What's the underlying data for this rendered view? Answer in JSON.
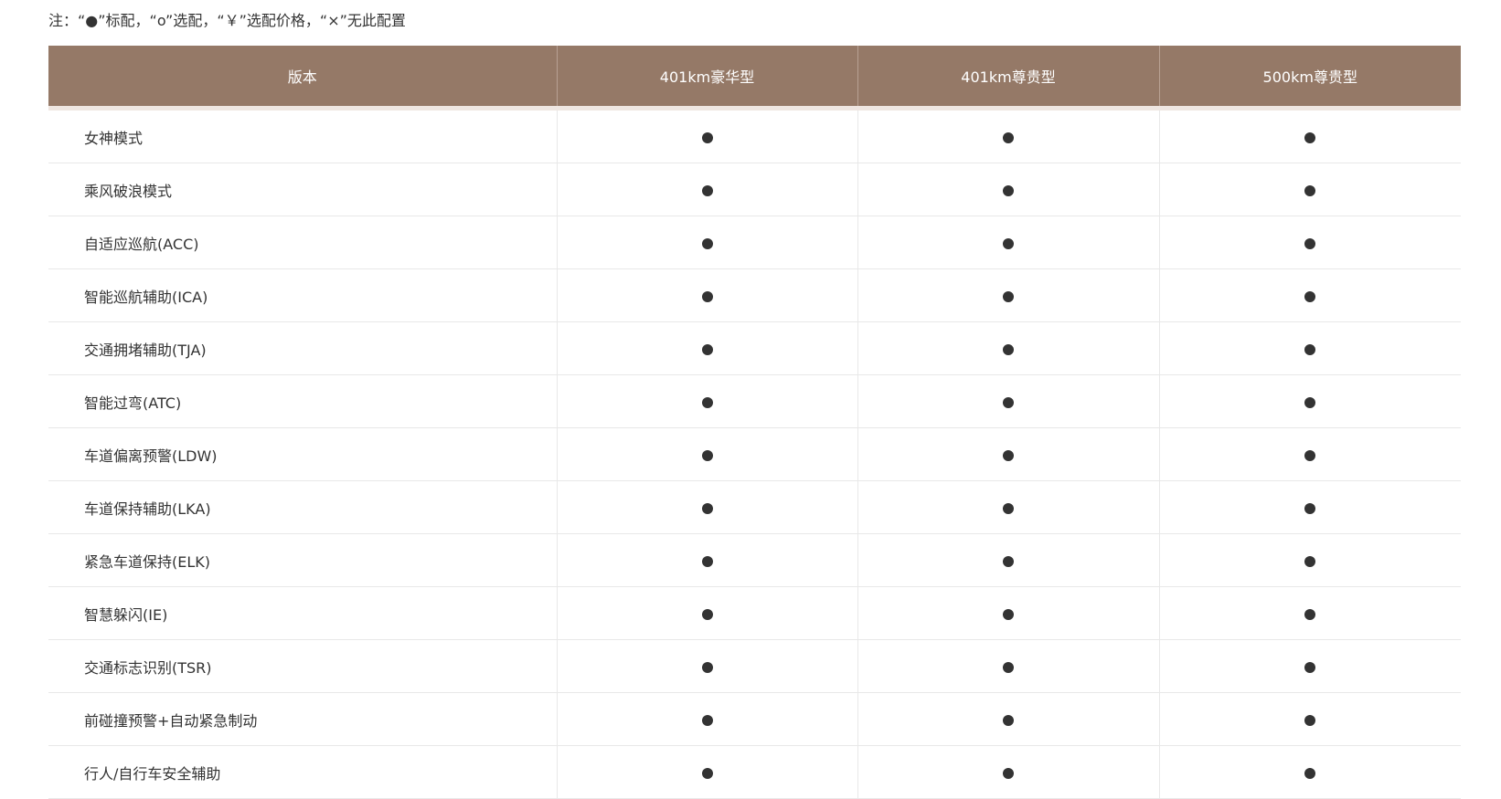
{
  "note": "注：“●”标配，“o”选配，“￥”选配价格，“×”无此配置",
  "table": {
    "headers": [
      "版本",
      "401km豪华型",
      "401km尊贵型",
      "500km尊贵型"
    ],
    "rows": [
      {
        "feature": "女神模式",
        "values": [
          "standard",
          "standard",
          "standard"
        ]
      },
      {
        "feature": "乘风破浪模式",
        "values": [
          "standard",
          "standard",
          "standard"
        ]
      },
      {
        "feature": "自适应巡航(ACC)",
        "values": [
          "standard",
          "standard",
          "standard"
        ]
      },
      {
        "feature": "智能巡航辅助(ICA)",
        "values": [
          "standard",
          "standard",
          "standard"
        ]
      },
      {
        "feature": "交通拥堵辅助(TJA)",
        "values": [
          "standard",
          "standard",
          "standard"
        ]
      },
      {
        "feature": "智能过弯(ATC)",
        "values": [
          "standard",
          "standard",
          "standard"
        ]
      },
      {
        "feature": "车道偏离预警(LDW)",
        "values": [
          "standard",
          "standard",
          "standard"
        ]
      },
      {
        "feature": "车道保持辅助(LKA)",
        "values": [
          "standard",
          "standard",
          "standard"
        ]
      },
      {
        "feature": "紧急车道保持(ELK)",
        "values": [
          "standard",
          "standard",
          "standard"
        ]
      },
      {
        "feature": "智慧躲闪(IE)",
        "values": [
          "standard",
          "standard",
          "standard"
        ]
      },
      {
        "feature": "交通标志识别(TSR)",
        "values": [
          "standard",
          "standard",
          "standard"
        ]
      },
      {
        "feature": "前碰撞预警+自动紧急制动",
        "values": [
          "standard",
          "standard",
          "standard"
        ]
      },
      {
        "feature": "行人/自行车安全辅助",
        "values": [
          "standard",
          "standard",
          "standard"
        ]
      }
    ]
  },
  "colors": {
    "header_bg": "#957967",
    "header_text": "#ffffff",
    "dot": "#333333"
  },
  "icons": {
    "standard": "filled-dot-icon"
  }
}
